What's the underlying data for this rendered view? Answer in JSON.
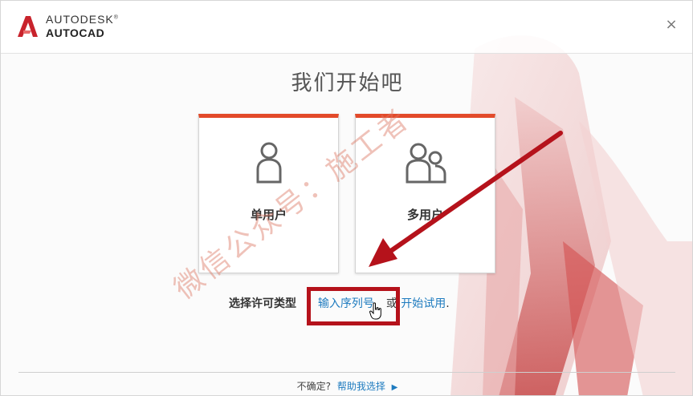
{
  "app": {
    "brand_line1": "AUTODESK",
    "brand_trademark": "®",
    "brand_line2": "AUTOCAD",
    "close_symbol": "×"
  },
  "main": {
    "title": "我们开始吧",
    "cards": [
      {
        "label": "单用户",
        "icon": "single-user-icon"
      },
      {
        "label": "多用户",
        "icon": "multi-user-icon"
      }
    ],
    "choose_label": "选择许可类型",
    "serial_link": "输入序列号",
    "or_text": "或",
    "trial_link": "开始试用",
    "period": "."
  },
  "footer": {
    "unsure_text": "不确定?",
    "help_link": "帮助我选择",
    "arrow": "▶"
  },
  "overlay": {
    "watermark": "微信公众号：施工者"
  },
  "colors": {
    "accent_orange": "#e34a2a",
    "link_blue": "#1e7bbf",
    "annotation_red": "#b5121b"
  }
}
